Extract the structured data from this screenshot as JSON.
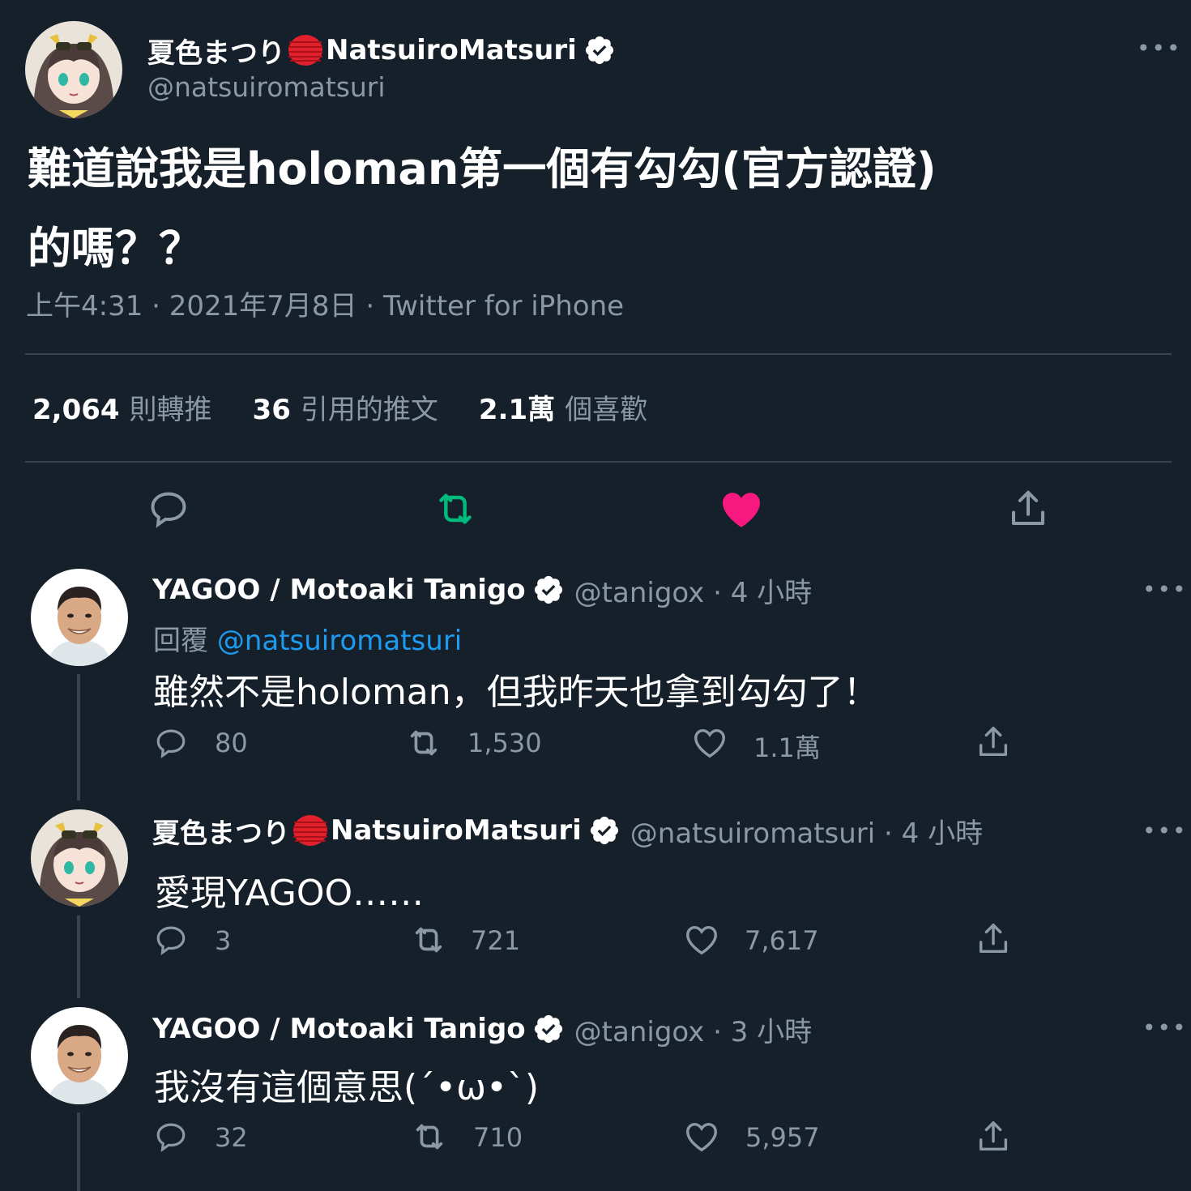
{
  "main_tweet": {
    "display_name_jp": "夏色まつり",
    "display_name_en": "NatsuiroMatsuri",
    "handle": "@natsuiromatsuri",
    "text_line1": "難道說我是holoman第一個有勾勾(官方認證)",
    "text_line2": "的嗎？？",
    "meta": "上午4:31 · 2021年7月8日 · Twitter for iPhone",
    "retweets_count": "2,064",
    "retweets_label": "則轉推",
    "quotes_count": "36",
    "quotes_label": "引用的推文",
    "likes_count": "2.1萬",
    "likes_label": "個喜歡",
    "more": "•••"
  },
  "replies": [
    {
      "display_name": "YAGOO / Motoaki Tanigo",
      "handle_time": "@tanigox · 4 小時",
      "reply_to_label": "回覆",
      "reply_to_handle": "@natsuiromatsuri",
      "text": "雖然不是holoman，但我昨天也拿到勾勾了！",
      "replies": "80",
      "retweets": "1,530",
      "likes": "1.1萬",
      "more": "•••"
    },
    {
      "display_name_jp": "夏色まつり",
      "display_name_en": "NatsuiroMatsuri",
      "handle_time": "@natsuiromatsuri · 4 小時",
      "text": "愛現YAGOO……",
      "replies": "3",
      "retweets": "721",
      "likes": "7,617",
      "more": "•••"
    },
    {
      "display_name": "YAGOO / Motoaki Tanigo",
      "handle_time": "@tanigox · 3 小時",
      "text": "我沒有這個意思(´•ω•`)",
      "replies": "32",
      "retweets": "710",
      "likes": "5,957",
      "more": "•••"
    }
  ],
  "icons": {
    "reply": "speech-bubble-icon",
    "retweet": "retweet-arrows-icon",
    "like": "heart-icon",
    "share": "share-upload-icon",
    "verified": "verified-badge-icon",
    "flag": "red-circle-flag-icon"
  },
  "colors": {
    "background": "#15202b",
    "text": "#ffffff",
    "secondary": "#8b98a5",
    "divider": "#38444d",
    "mention": "#1d9bf0",
    "retweet_active": "#00ba7c",
    "like_active": "#f91880"
  }
}
